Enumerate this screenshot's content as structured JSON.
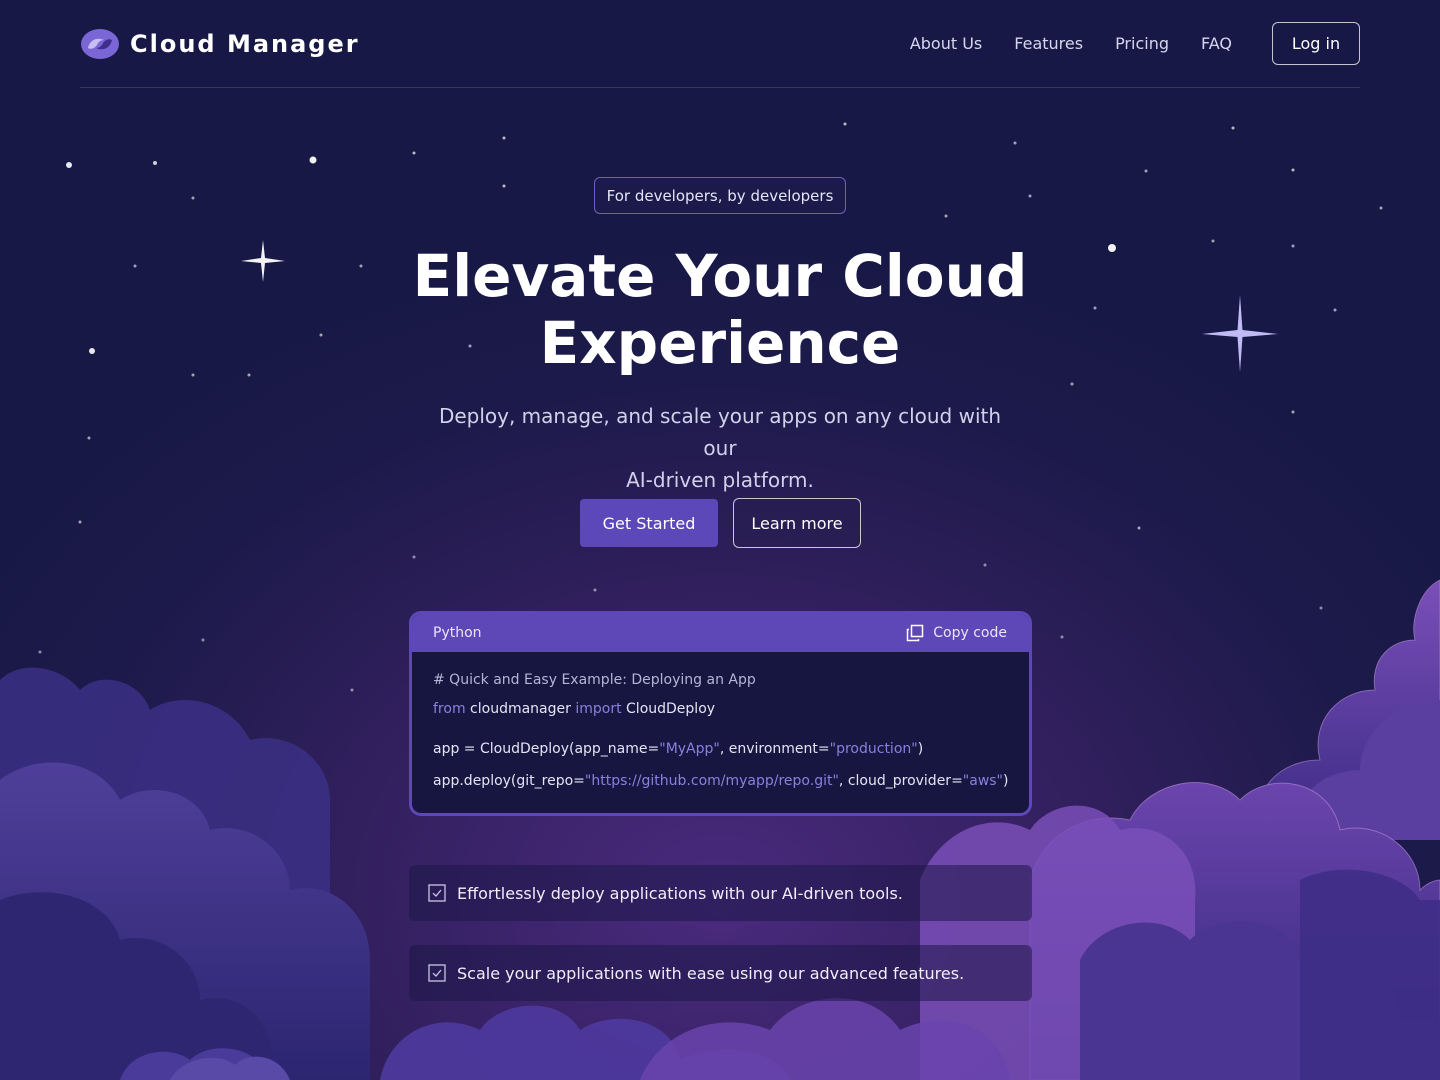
{
  "nav": {
    "brand": "Cloud Manager",
    "links": [
      {
        "label": "About Us"
      },
      {
        "label": "Features"
      },
      {
        "label": "Pricing"
      },
      {
        "label": "FAQ"
      }
    ],
    "login_label": "Log in"
  },
  "hero": {
    "badge": "For developers, by developers",
    "title_line1": "Elevate Your Cloud",
    "title_line2": "Experience",
    "subtitle_line1": "Deploy, manage, and scale your apps on any cloud with our",
    "subtitle_line2": "AI-driven platform.",
    "primary_label": "Get Started",
    "secondary_label": "Learn more"
  },
  "code": {
    "language": "Python",
    "copy_label": "Copy code",
    "comment": "# Quick and Easy Example: Deploying an App",
    "line2": {
      "kw_from": "from",
      "module": " cloudmanager ",
      "kw_import": "import",
      "name": " CloudDeploy"
    },
    "line3": {
      "a": "app = CloudDeploy(app_name=",
      "s1": "\"MyApp\"",
      "b": ", environment=",
      "s2": "\"production\"",
      "c": ")"
    },
    "line4": {
      "a": "app.deploy(git_repo=",
      "s1": "\"https://github.com/myapp/repo.git\"",
      "b": ", cloud_provider=",
      "s2": "\"aws\"",
      "c": ")"
    }
  },
  "features": [
    {
      "text": "Effortlessly deploy applications with our AI-driven tools."
    },
    {
      "text": "Scale your applications with ease using our advanced features."
    }
  ],
  "colors": {
    "background": "#1c1a4a",
    "accent": "#5c48b8",
    "code_keyword": "#8b7fe0"
  }
}
